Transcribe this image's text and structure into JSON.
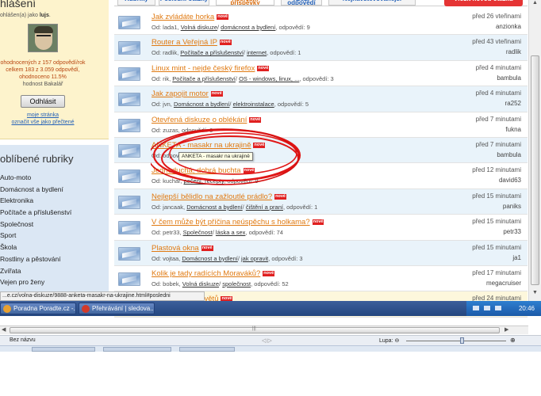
{
  "login": {
    "title": "hlášení",
    "user_prefix": "ohlášen(a) jako",
    "user_name": "lujs",
    "stats": [
      "ohodnocených z 157 odpovědí/rok",
      "celkem 183 z 3.059 odpovědí,",
      "ohodnoceno 11.5%"
    ],
    "stats_gray": "hodnost Bakalář",
    "logout_label": "Odhlásit",
    "my_page_label": "moje stránka",
    "mark_read_label": "označit vše jako přečtené"
  },
  "categories": {
    "title": "oblíbené rubriky",
    "items": [
      "Auto-moto",
      "Domácnost a bydlení",
      "Elektronika",
      "Počítače a příslušenství",
      "Společnost",
      "Sport",
      "Škola",
      "Rostliny a pěstování",
      "Zvířata",
      "Vejen pro ženy"
    ]
  },
  "tabs": [
    {
      "label": "Rubriky",
      "active": false
    },
    {
      "label": "Poslední otázky",
      "active": false
    },
    {
      "label": "Poslední příspěvky",
      "active": true
    },
    {
      "label": "Bez odpovědí",
      "active": false
    },
    {
      "label": "Nejnavštěvovanější",
      "active": false
    }
  ],
  "ask_button": "Vložit novou otázku",
  "questions": [
    {
      "title": "Jak zvládáte horka",
      "badge": "nové",
      "from": "Od: lada1,",
      "cat1": "Volná diskuze",
      "cat2": "domácnost a bydlení",
      "answers": ", odpovědí: 9",
      "time": "před 26 vteřinami",
      "user": "anzionka",
      "bg": "alt"
    },
    {
      "title": "Router a Veřejná IP",
      "badge": "nové",
      "from": "Od: radlik,",
      "cat1": "Počítače a příslušenství",
      "cat2": "internet",
      "answers": ", odpovědí: 1",
      "time": "před 43 vteřinami",
      "user": "radlik",
      "bg": "blue"
    },
    {
      "title": "Linux mint - nejde český firefox",
      "badge": "nové",
      "from": "Od: rik,",
      "cat1": "Počítače a příslušenství",
      "cat2": "OS - windows, linux, ...",
      "answers": ", odpovědí: 3",
      "time": "před 4 minutami",
      "user": "bambula",
      "bg": "alt"
    },
    {
      "title": "Jak zapojit motor",
      "badge": "nové",
      "from": "Od: jvn,",
      "cat1": "Domácnost a bydlení",
      "cat2": "elektroinstalace",
      "answers": ", odpovědí: 5",
      "time": "před 4 minutami",
      "user": "ra252",
      "bg": "blue"
    },
    {
      "title": "Otevřená diskuze o oblékání",
      "badge": "nové",
      "from": "Od: zuzas,",
      "cat1": "",
      "cat2": "",
      "answers": "odpovědí: 6",
      "time": "před 7 minutami",
      "user": "fukna",
      "bg": "alt"
    },
    {
      "title": "ANKETA - masakr na ukrajině",
      "badge": "nové",
      "from": "Od:",
      "cat1": "",
      "cat2": "",
      "answers": "odpovědí: 3",
      "time": "před 7 minutami",
      "user": "bambula",
      "bg": "blue"
    },
    {
      "title": "Jednoduchá, dobrá buchta",
      "badge": "nové",
      "from": "Od: kuchar,",
      "cat1": "",
      "cat2": "pečení, recepty",
      "answers": ", odpovědí: 9",
      "time": "před 12 minutami",
      "user": "david63",
      "bg": "alt"
    },
    {
      "title": "Nejlepší bělidlo na zažloutlé prádlo?",
      "badge": "nové",
      "from": "Od: jancaak,",
      "cat1": "Domácnost a bydlení",
      "cat2": "čištění a praní",
      "answers": ", odpovědí: 1",
      "time": "před 15 minutami",
      "user": "paniks",
      "bg": "blue"
    },
    {
      "title": "V čem může být příčina neúspěchu s holkama?",
      "badge": "nové",
      "from": "Od: petr33,",
      "cat1": "Společnost",
      "cat2": "láska a sex",
      "answers": ", odpovědí: 74",
      "time": "před 15 minutami",
      "user": "petr33",
      "bg": "alt"
    },
    {
      "title": "Plastová okna",
      "badge": "nové",
      "from": "Od: vojtaa,",
      "cat1": "Domácnost a bydlení",
      "cat2": "jak opravit",
      "answers": ", odpovědí: 3",
      "time": "před 15 minutami",
      "user": "ja1",
      "bg": "blue"
    },
    {
      "title": "Kolik je tady radících Moraváků?",
      "badge": "nové",
      "from": "Od: bobek,",
      "cat1": "Volná diskuze",
      "cat2": "společnost",
      "answers": ", odpovědí: 52",
      "time": "před 17 minutami",
      "user": "megacruiser",
      "bg": "alt"
    },
    {
      "title": "Nejlepší úlovy květů",
      "badge": "nové",
      "from": "",
      "cat1": "",
      "cat2": "",
      "answers": "",
      "time": "před 24 minutami",
      "user": "",
      "bg": "yellow"
    }
  ],
  "tooltip": "ANKETA - masakr na ukrajině",
  "status_url": "...e.cz/volna-diskuze/9888-anketa-masakr-na-ukrajine.html#posledni",
  "taskbar": {
    "tasks": [
      {
        "label": "Poradna Poradte.cz -...",
        "color": "#e8a030"
      },
      {
        "label": "Přehrávání | sledova...",
        "color": "#d23a2a"
      }
    ],
    "clock": "20:46"
  },
  "browser_status": {
    "zone": "Bez názvu",
    "zoom_label": "Lupa:",
    "zoom_minus": "⊖",
    "zoom_plus": "⊕"
  },
  "colors": {
    "accent_orange": "#e07a12",
    "link_blue": "#2461b8",
    "ask_red": "#e53434",
    "badge_red": "#e02020"
  }
}
